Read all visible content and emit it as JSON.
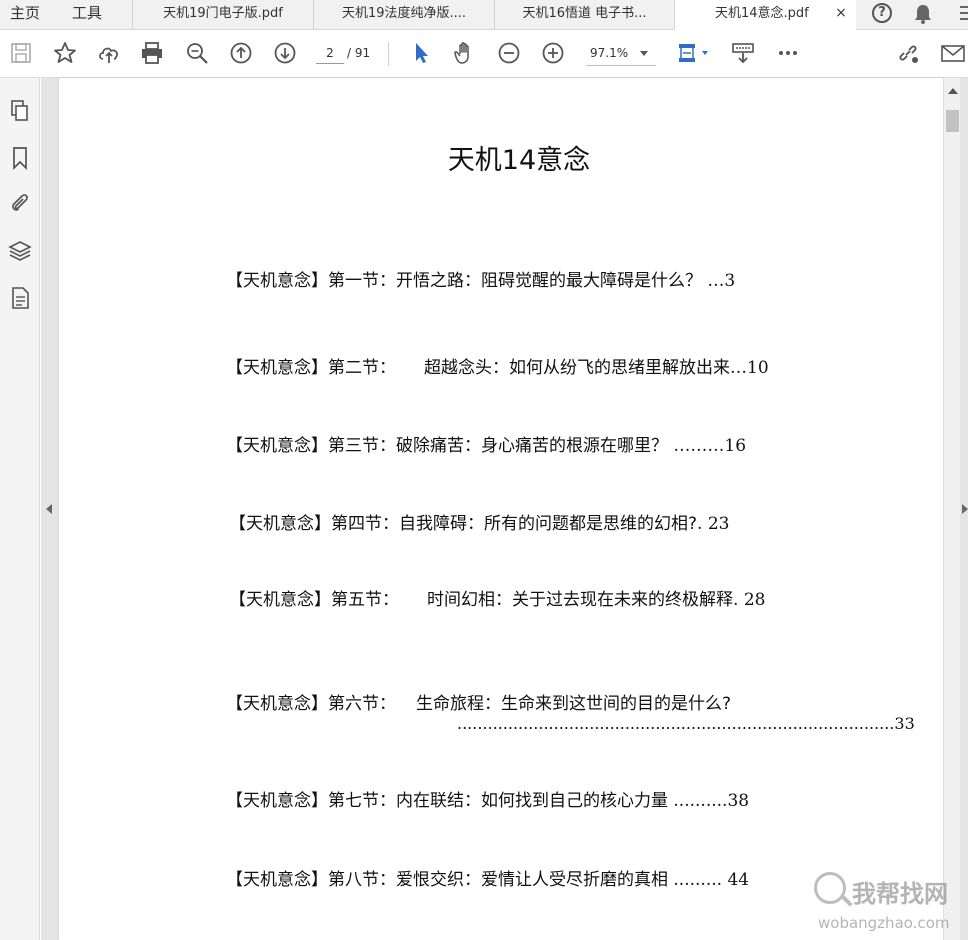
{
  "tabbar": {
    "home_label": "主页",
    "tools_label": "工具",
    "tabs": [
      {
        "label": "天机19门电子版.pdf"
      },
      {
        "label": "天机19法度纯净版...."
      },
      {
        "label": "天机16悟道 电子书..."
      },
      {
        "label": "天机14意念.pdf"
      }
    ],
    "close_glyph": "×",
    "help_glyph": "?"
  },
  "toolbar": {
    "page_current": "2",
    "page_total": "/ 91",
    "zoom": "97.1%",
    "icons": [
      "save-icon",
      "star-icon",
      "upload-cloud-icon",
      "print-icon",
      "zoom-out-search-icon",
      "page-up-icon",
      "page-down-icon",
      "select-arrow-icon",
      "hand-icon",
      "zoom-minus-icon",
      "zoom-plus-icon",
      "fit-page-icon",
      "keyboard-icon",
      "more-icon",
      "link-icon",
      "mail-icon"
    ]
  },
  "leftrail": {
    "icons": [
      "pages-icon",
      "bookmark-icon",
      "attachment-icon",
      "layers-icon",
      "document-properties-icon"
    ]
  },
  "document": {
    "title": "天机14意念",
    "toc": [
      {
        "prefix": "【天机意念】第一节：",
        "text": "开悟之路：阻碍觉醒的最大障碍是什么？",
        "leader": "  …",
        "page": "3"
      },
      {
        "prefix": "【天机意念】第二节：",
        "text": "超越念头：如何从纷飞的思绪里解放出来",
        "leader": "…",
        "page": "10"
      },
      {
        "prefix": "【天机意念】第三节：",
        "text": "破除痛苦：身心痛苦的根源在哪里？",
        "leader": "  ………",
        "page": "16"
      },
      {
        "prefix": "【天机意念】第四节：",
        "text": "自我障碍：所有的问题都是思维的幻相?",
        "leader": ".  ",
        "page": "23"
      },
      {
        "prefix": "【天机意念】第五节：",
        "text": "时间幻相：关于过去现在未来的终极解释",
        "leader": ". ",
        "page": "28"
      },
      {
        "prefix": "【天机意念】第六节：",
        "text": "生命旅程：生命来到这世间的目的是什么?",
        "leader": "",
        "page": ""
      },
      {
        "prefix": "【天机意念】第七节：",
        "text": "内在联结：如何找到自己的核心力量",
        "leader": " ..........",
        "page": "38"
      },
      {
        "prefix": "【天机意念】第八节：",
        "text": "爱恨交织：爱情让人受尽折磨的真相",
        "leader": " .........  ",
        "page": "44"
      }
    ],
    "toc6_continuation": "......................................................................................33"
  },
  "watermark": {
    "cn": "我帮找网",
    "en": "wobangzhao.com"
  }
}
